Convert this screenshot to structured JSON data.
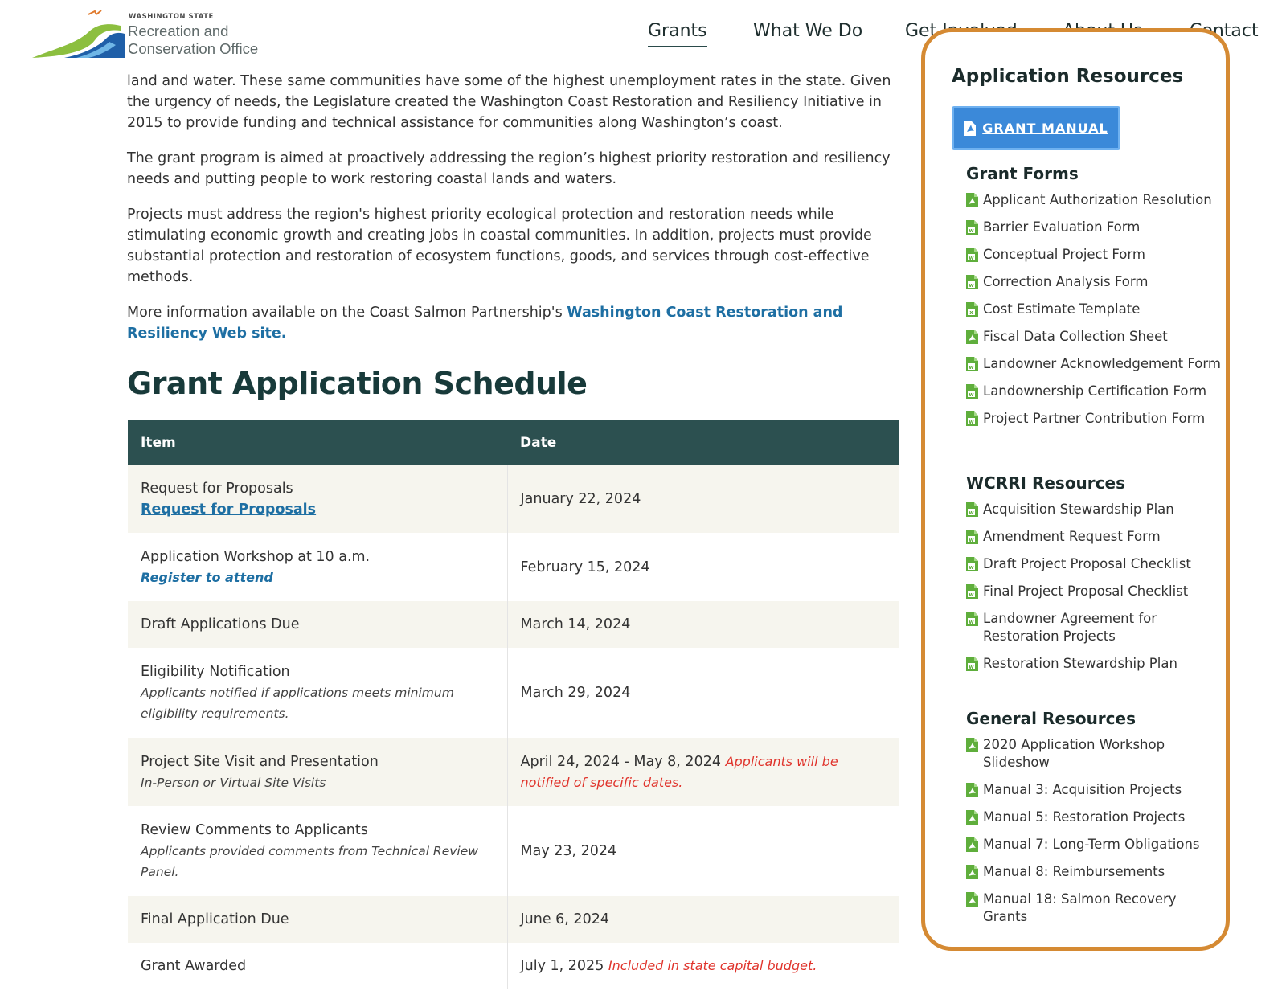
{
  "logo": {
    "state": "WASHINGTON STATE",
    "line1": "Recreation and",
    "line2": "Conservation Office"
  },
  "nav": {
    "items": [
      "Grants",
      "What We Do",
      "Get Involved",
      "About Us",
      "Contact"
    ],
    "active": "Grants"
  },
  "content": {
    "p1": "land and water. These same communities have some of the highest unemployment rates in the state. Given the urgency of needs, the Legislature created the Washington Coast Restoration and Resiliency Initiative in 2015 to provide funding and technical assistance for communities along Washington’s coast.",
    "p2": "The grant program is aimed at proactively addressing the region’s highest priority restoration and resiliency needs and putting people to work restoring coastal lands and waters.",
    "p3": "Projects must address the region's highest priority ecological protection and restoration needs while stimulating economic growth and creating jobs in coastal communities. In addition, projects must provide substantial protection and restoration of ecosystem functions, goods, and services through cost-effective methods.",
    "p4_prefix": "More information available on the Coast Salmon Partnership's ",
    "p4_link": "Washington Coast Restoration and Resiliency Web site."
  },
  "schedule": {
    "heading": "Grant Application Schedule",
    "col_item": "Item",
    "col_date": "Date",
    "rows": [
      {
        "item": "Request for Proposals",
        "link": "Request for Proposals",
        "date": "January 22, 2024"
      },
      {
        "item": "Application Workshop at 10 a.m.",
        "sublink": "Register to attend",
        "date": "February 15, 2024"
      },
      {
        "item": "Draft Applications Due",
        "date": "March 14, 2024"
      },
      {
        "item": "Eligibility Notification",
        "note": "Applicants notified if applications meets minimum eligibility requirements.",
        "date": "March 29, 2024"
      },
      {
        "item": "Project Site Visit and Presentation",
        "note": "In-Person or Virtual Site Visits",
        "date": "April 24, 2024 - May 8, 2024",
        "date_note": "Applicants will be notified of specific dates."
      },
      {
        "item": "Review Comments to Applicants",
        "note": "Applicants provided comments from Technical Review Panel.",
        "date": "May 23, 2024"
      },
      {
        "item": "Final Application Due",
        "date": "June 6, 2024"
      },
      {
        "item": "Grant Awarded",
        "date": "July 1, 2025",
        "date_note": "Included in state capital budget."
      }
    ]
  },
  "sidebar": {
    "title": "Application Resources",
    "manual_button": "GRANT MANUAL",
    "grant_forms": {
      "heading": "Grant Forms",
      "items": [
        {
          "label": "Applicant Authorization Resolution",
          "icon": "pdf-file-icon"
        },
        {
          "label": "Barrier Evaluation Form",
          "icon": "word-file-icon"
        },
        {
          "label": "Conceptual Project Form",
          "icon": "word-file-icon"
        },
        {
          "label": "Correction Analysis Form",
          "icon": "word-file-icon"
        },
        {
          "label": "Cost Estimate Template",
          "icon": "excel-file-icon"
        },
        {
          "label": "Fiscal Data Collection Sheet",
          "icon": "pdf-file-icon"
        },
        {
          "label": "Landowner Acknowledgement Form",
          "icon": "word-file-icon"
        },
        {
          "label": "Landownership Certification Form",
          "icon": "word-file-icon"
        },
        {
          "label": "Project Partner Contribution Form",
          "icon": "word-file-icon"
        }
      ]
    },
    "wcrri": {
      "heading": "WCRRI Resources",
      "items": [
        {
          "label": "Acquisition Stewardship Plan",
          "icon": "word-file-icon"
        },
        {
          "label": "Amendment Request Form",
          "icon": "word-file-icon"
        },
        {
          "label": "Draft Project Proposal Checklist",
          "icon": "word-file-icon"
        },
        {
          "label": "Final Project Proposal Checklist",
          "icon": "word-file-icon"
        },
        {
          "label": "Landowner Agreement for Restoration Projects",
          "icon": "word-file-icon"
        },
        {
          "label": "Restoration Stewardship Plan",
          "icon": "word-file-icon"
        }
      ]
    },
    "general": {
      "heading": "General Resources",
      "items": [
        {
          "label": "2020 Application Workshop Slideshow",
          "icon": "pdf-file-icon"
        },
        {
          "label": "Manual 3: Acquisition Projects",
          "icon": "pdf-file-icon"
        },
        {
          "label": "Manual 5: Restoration Projects",
          "icon": "pdf-file-icon"
        },
        {
          "label": "Manual 7: Long-Term Obligations",
          "icon": "pdf-file-icon"
        },
        {
          "label": "Manual 8: Reimbursements",
          "icon": "pdf-file-icon"
        },
        {
          "label": "Manual 18: Salmon Recovery Grants",
          "icon": "pdf-file-icon"
        }
      ]
    }
  },
  "colors": {
    "accent_green": "#5fae3c",
    "table_header": "#2c5050",
    "link_blue": "#1e6fa3",
    "highlight_orange": "#d58a33",
    "button_blue": "#3b89d9",
    "note_red": "#e0342c"
  }
}
